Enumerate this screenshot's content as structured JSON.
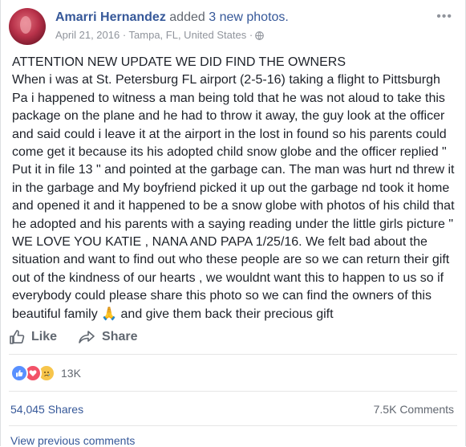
{
  "post": {
    "author": "Amarri Hernandez",
    "verb": "added",
    "photos_link": "3 new photos.",
    "date": "April 21, 2016 · Tampa, FL, United States ·",
    "more_menu": "•••",
    "text": "ATTENTION NEW UPDATE WE DID FIND THE OWNERS\nWhen i was at St. Petersburg FL airport (2-5-16) taking a flight to Pittsburgh Pa i happened to witness a man being told that he was not aloud to take this package on the plane and he had to throw it away, the guy look at the officer and said could i leave it at the airport in the lost in found so his parents could come get it because its his adopted child snow globe and the officer replied \" Put it in file 13 \" and pointed at the garbage can. The man was hurt nd threw it in the garbage and My boyfriend picked it up out the garbage nd took it home and opened it and it happened to be a snow globe with photos of his child that he adopted and his parents with a saying reading under the little girls picture \" WE LOVE YOU KATIE , NANA AND PAPA 1/25/16. We felt bad about the situation and want to find out who these people are so we can return their gift out of the kindness of our hearts , we wouldnt want this to happen to us so if everybody could please share this photo so we can find the owners of this beautiful family 🙏 and give them back their precious gift"
  },
  "actions": {
    "like_label": "Like",
    "share_label": "Share"
  },
  "reactions": {
    "icons": [
      "like-icon",
      "love-icon",
      "sad-icon"
    ],
    "count": "13K"
  },
  "stats": {
    "shares": "54,045 Shares",
    "comments": "7.5K Comments"
  },
  "comments": {
    "view_previous": "View previous comments"
  },
  "colors": {
    "link": "#365899",
    "secondary": "#90949c",
    "text": "#1d2129"
  }
}
